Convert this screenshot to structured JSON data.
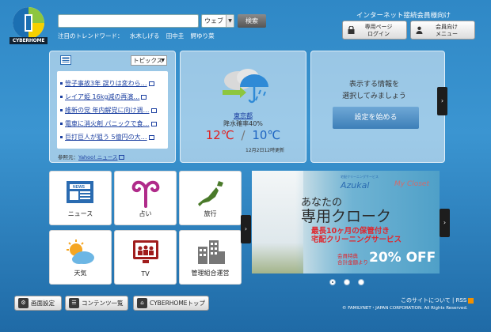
{
  "brand": {
    "logo_text": "CYBERHOME"
  },
  "search": {
    "select_value": "ウェブ",
    "button_label": "検索"
  },
  "trending": {
    "label": "注目のトレンドワード：",
    "words": [
      "水木しげる",
      "田中圭",
      "鰐ゆり菜"
    ]
  },
  "member": {
    "label": "インターネット接続会員様向け",
    "login_label": "専用ページ\nログイン",
    "menu_label": "会員向け\nメニュー"
  },
  "topics": {
    "selected": "トピックス",
    "items": [
      "笹子事故3年 誤りは変わら…",
      "レイア姫 16kg減の再演…",
      "維新の党 年内解党に向け调…",
      "電車に消火剤 パニックで食…",
      "巨打巨人が狙う 5億円の大…"
    ],
    "source_label": "参照元：",
    "source_link": "Yahoo! ニュース"
  },
  "weather": {
    "city": "東京都",
    "rain": "降水確率40%",
    "high": "12℃",
    "sep": "/",
    "low": "10℃",
    "updated": "12月2日12時更新"
  },
  "info": {
    "line1": "表示する情報を",
    "line2": "選択してみましょう",
    "button": "設定を始める"
  },
  "tiles": [
    {
      "label": "ニュース",
      "icon": "newspaper-icon"
    },
    {
      "label": "占い",
      "icon": "aries-icon"
    },
    {
      "label": "旅行",
      "icon": "japan-map-icon"
    },
    {
      "label": "天気",
      "icon": "sun-cloud-icon"
    },
    {
      "label": "TV",
      "icon": "tv-icon"
    },
    {
      "label": "管理組合運営",
      "icon": "building-icon"
    }
  ],
  "banner": {
    "brand_small": "宅配クリーニングサービス",
    "brand": "Azukal",
    "brand2": "My Closet",
    "line1": "あなたの",
    "line2": "専用クローク",
    "line3": "最長10ヶ月の保管付き",
    "line4": "宅配クリーニングサービス",
    "line5a": "会員特典",
    "line5b": "合計金額より",
    "line6": "20% OFF"
  },
  "bottom": {
    "screen_settings": "画面設定",
    "content_list": "コンテンツ一覧",
    "home_top": "CYBERHOMEトップ"
  },
  "footer": {
    "about": "このサイトについて",
    "sep": "|",
    "rss": "RSS",
    "copyright": "© FAMILYNET・JAPAN CORPORATION. All Rights Reserved."
  },
  "colors": {
    "accent": "#2f88c6",
    "hot": "#e02020",
    "cold": "#1f66c2",
    "link": "#1b3fa0"
  }
}
